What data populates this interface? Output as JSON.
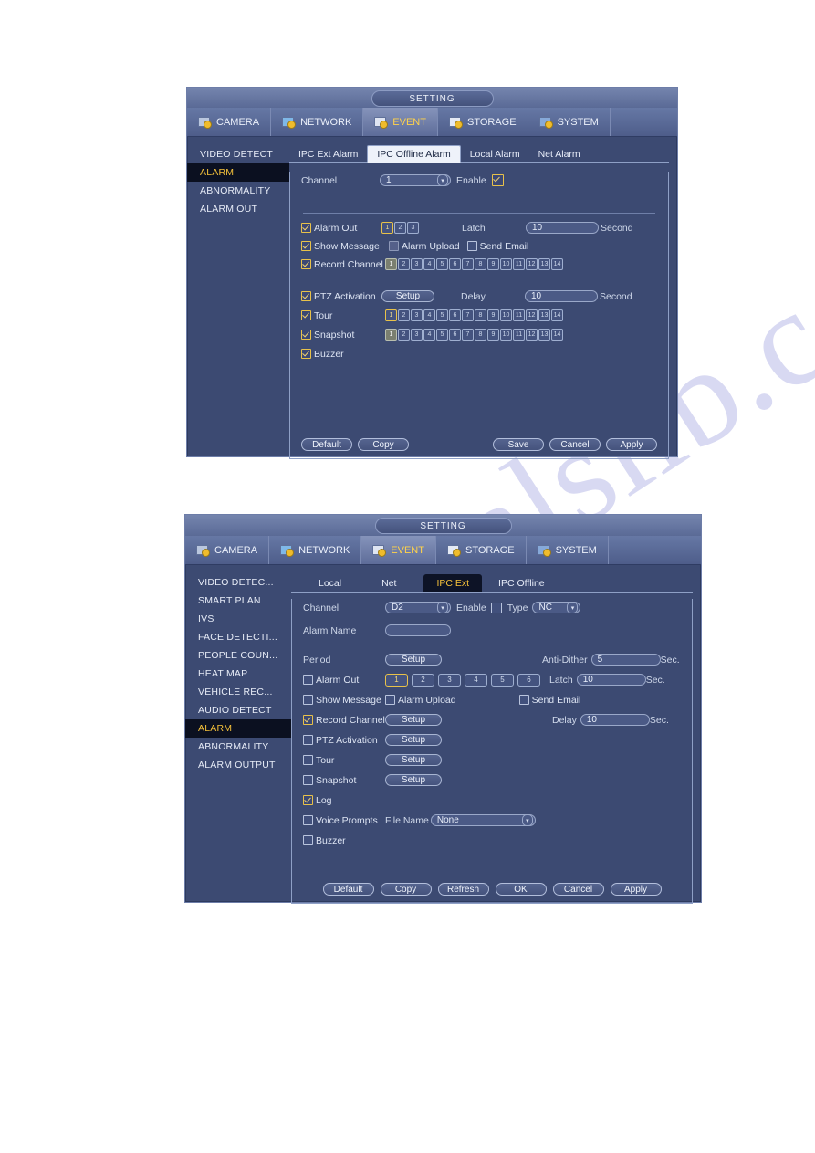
{
  "watermark": {
    "text": "manualslib.com"
  },
  "dialog1": {
    "title": "SETTING",
    "top_tabs": [
      {
        "label": "CAMERA",
        "icon": "camera-gear-icon",
        "active": false
      },
      {
        "label": "NETWORK",
        "icon": "network-gear-icon",
        "active": false
      },
      {
        "label": "EVENT",
        "icon": "event-gear-icon",
        "active": true
      },
      {
        "label": "STORAGE",
        "icon": "storage-gear-icon",
        "active": false
      },
      {
        "label": "SYSTEM",
        "icon": "system-gear-icon",
        "active": false
      }
    ],
    "sidebar": [
      {
        "label": "VIDEO DETECT",
        "active": false
      },
      {
        "label": "ALARM",
        "active": true
      },
      {
        "label": "ABNORMALITY",
        "active": false
      },
      {
        "label": "ALARM OUT",
        "active": false
      }
    ],
    "sub_tabs": [
      {
        "label": "IPC Ext Alarm",
        "active": false
      },
      {
        "label": "IPC Offline Alarm",
        "active": true
      },
      {
        "label": "Local Alarm",
        "active": false
      },
      {
        "label": "Net Alarm",
        "active": false
      }
    ],
    "channel_label": "Channel",
    "channel_value": "1",
    "enable_label": "Enable",
    "enable_checked": true,
    "alarm_out_label": "Alarm Out",
    "alarm_out_checked": true,
    "alarm_out_chips": [
      "1",
      "2",
      "3"
    ],
    "alarm_out_selected": "1",
    "latch_label": "Latch",
    "latch_value": "10",
    "latch_unit": "Second",
    "show_message_label": "Show Message",
    "show_message_checked": true,
    "alarm_upload_label": "Alarm Upload",
    "alarm_upload_checked": false,
    "send_email_label": "Send Email",
    "send_email_checked": false,
    "record_channel_label": "Record Channel",
    "record_channel_checked": true,
    "record_channels": [
      "1",
      "2",
      "3",
      "4",
      "5",
      "6",
      "7",
      "8",
      "9",
      "10",
      "11",
      "12",
      "13",
      "14"
    ],
    "record_channel_on": "1",
    "ptz_label": "PTZ Activation",
    "ptz_checked": true,
    "ptz_setup_label": "Setup",
    "delay_label": "Delay",
    "delay_value": "10",
    "delay_unit": "Second",
    "tour_label": "Tour",
    "tour_checked": true,
    "tour_channels": [
      "1",
      "2",
      "3",
      "4",
      "5",
      "6",
      "7",
      "8",
      "9",
      "10",
      "11",
      "12",
      "13",
      "14"
    ],
    "tour_selected": "1",
    "snapshot_label": "Snapshot",
    "snapshot_checked": true,
    "snapshot_channels": [
      "1",
      "2",
      "3",
      "4",
      "5",
      "6",
      "7",
      "8",
      "9",
      "10",
      "11",
      "12",
      "13",
      "14"
    ],
    "snapshot_on": "1",
    "buzzer_label": "Buzzer",
    "buzzer_checked": true,
    "footer_left": [
      "Default",
      "Copy"
    ],
    "footer_right": [
      "Save",
      "Cancel",
      "Apply"
    ]
  },
  "dialog2": {
    "title": "SETTING",
    "top_tabs": [
      {
        "label": "CAMERA",
        "icon": "camera-gear-icon",
        "active": false
      },
      {
        "label": "NETWORK",
        "icon": "network-gear-icon",
        "active": false
      },
      {
        "label": "EVENT",
        "icon": "event-gear-icon",
        "active": true
      },
      {
        "label": "STORAGE",
        "icon": "storage-gear-icon",
        "active": false
      },
      {
        "label": "SYSTEM",
        "icon": "system-gear-icon",
        "active": false
      }
    ],
    "sidebar": [
      {
        "label": "VIDEO DETEC...",
        "active": false
      },
      {
        "label": "SMART PLAN",
        "active": false
      },
      {
        "label": "IVS",
        "active": false
      },
      {
        "label": "FACE DETECTI...",
        "active": false
      },
      {
        "label": "PEOPLE COUN...",
        "active": false
      },
      {
        "label": "HEAT MAP",
        "active": false
      },
      {
        "label": "VEHICLE REC...",
        "active": false
      },
      {
        "label": "AUDIO DETECT",
        "active": false
      },
      {
        "label": "ALARM",
        "active": true
      },
      {
        "label": "ABNORMALITY",
        "active": false
      },
      {
        "label": "ALARM OUTPUT",
        "active": false
      }
    ],
    "sub_tabs": [
      {
        "label": "Local",
        "active": false
      },
      {
        "label": "Net",
        "active": false
      },
      {
        "label": "IPC Ext",
        "active": true
      },
      {
        "label": "IPC Offline",
        "active": false
      }
    ],
    "channel_label": "Channel",
    "channel_value": "D2",
    "enable_label": "Enable",
    "enable_checked": false,
    "type_label": "Type",
    "type_value": "NC",
    "alarm_name_label": "Alarm Name",
    "alarm_name_value": "",
    "period_label": "Period",
    "period_setup_label": "Setup",
    "anti_dither_label": "Anti-Dither",
    "anti_dither_value": "5",
    "anti_dither_unit": "Sec.",
    "alarm_out_label": "Alarm Out",
    "alarm_out_checked": false,
    "alarm_out_chips": [
      "1",
      "2",
      "3",
      "4",
      "5",
      "6"
    ],
    "alarm_out_selected": "1",
    "latch_label": "Latch",
    "latch_value": "10",
    "latch_unit": "Sec.",
    "show_message_label": "Show Message",
    "show_message_checked": false,
    "alarm_upload_label": "Alarm Upload",
    "alarm_upload_checked": false,
    "send_email_label": "Send Email",
    "send_email_checked": false,
    "record_channel_label": "Record Channel",
    "record_channel_checked": true,
    "record_channel_setup_label": "Setup",
    "delay_label": "Delay",
    "delay_value": "10",
    "delay_unit": "Sec.",
    "ptz_label": "PTZ Activation",
    "ptz_checked": false,
    "ptz_setup_label": "Setup",
    "tour_label": "Tour",
    "tour_checked": false,
    "tour_setup_label": "Setup",
    "snapshot_label": "Snapshot",
    "snapshot_checked": false,
    "snapshot_setup_label": "Setup",
    "log_label": "Log",
    "log_checked": true,
    "voice_prompts_label": "Voice Prompts",
    "voice_prompts_checked": false,
    "file_name_label": "File Name",
    "file_name_value": "None",
    "buzzer_label": "Buzzer",
    "buzzer_checked": false,
    "footer_buttons": [
      "Default",
      "Copy",
      "Refresh",
      "OK",
      "Cancel",
      "Apply"
    ]
  },
  "colors": {
    "dialog_bg": "#3c4a72",
    "titlebar": "#6b7ba6",
    "accent_yellow": "#f5c13a",
    "active_side_bg": "#0b1020",
    "text": "#dfe6f5"
  }
}
